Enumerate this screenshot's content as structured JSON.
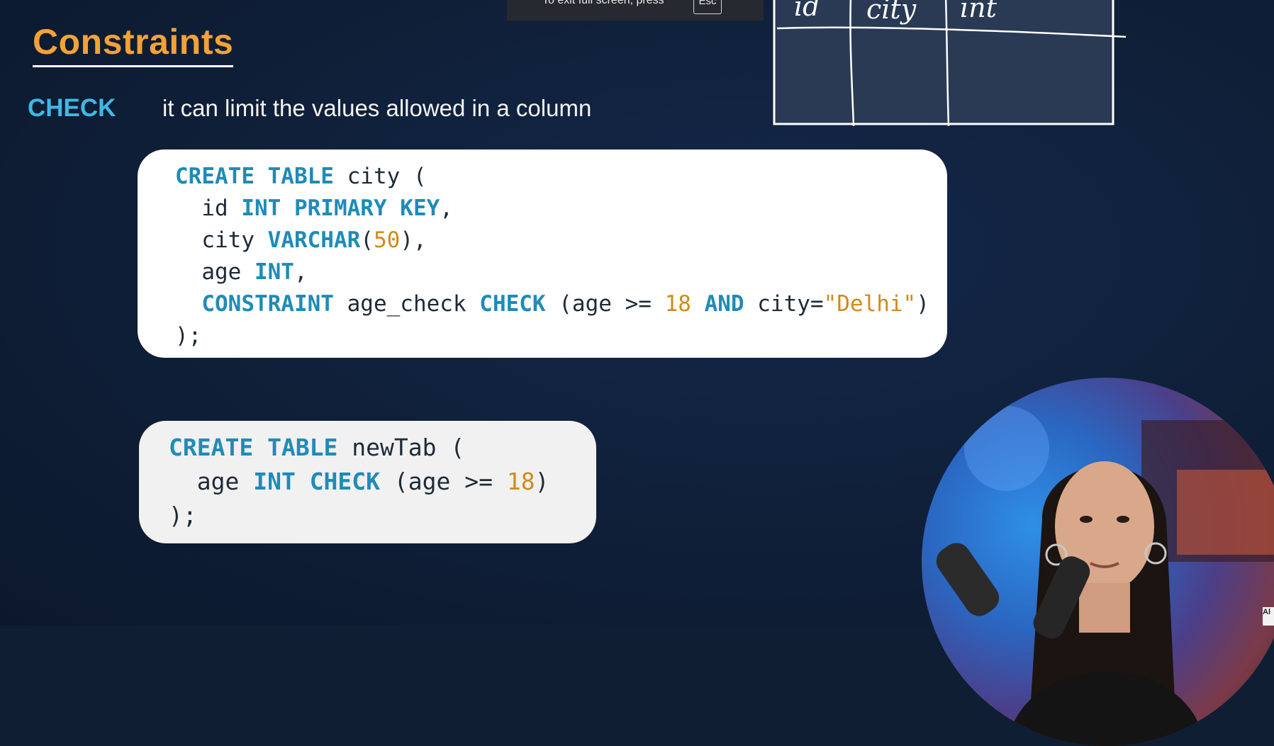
{
  "fullscreen_toast": {
    "message": "To exit full screen, press",
    "key": "Esc"
  },
  "slide": {
    "title": "Constraints",
    "keyword": "CHECK",
    "description": "it can limit the values allowed in a column"
  },
  "sketch_table": {
    "headers": [
      "id",
      "city",
      "int"
    ]
  },
  "code_block_1": {
    "lines": [
      [
        {
          "t": "CREATE TABLE",
          "c": "kw"
        },
        {
          "t": " city ("
        }
      ],
      [
        {
          "t": "  id "
        },
        {
          "t": "INT PRIMARY KEY",
          "c": "kw"
        },
        {
          "t": ","
        }
      ],
      [
        {
          "t": "  city "
        },
        {
          "t": "VARCHAR",
          "c": "kw"
        },
        {
          "t": "("
        },
        {
          "t": "50",
          "c": "num"
        },
        {
          "t": "),"
        }
      ],
      [
        {
          "t": "  age "
        },
        {
          "t": "INT",
          "c": "kw"
        },
        {
          "t": ","
        }
      ],
      [
        {
          "t": "  "
        },
        {
          "t": "CONSTRAINT",
          "c": "kw"
        },
        {
          "t": " age_check "
        },
        {
          "t": "CHECK",
          "c": "kw"
        },
        {
          "t": " (age >= "
        },
        {
          "t": "18",
          "c": "num"
        },
        {
          "t": " "
        },
        {
          "t": "AND",
          "c": "kw"
        },
        {
          "t": " city="
        },
        {
          "t": "\"Delhi\"",
          "c": "str"
        },
        {
          "t": ")"
        }
      ],
      [
        {
          "t": ");"
        }
      ]
    ]
  },
  "code_block_2": {
    "lines": [
      [
        {
          "t": "CREATE TABLE",
          "c": "kw"
        },
        {
          "t": " newTab ("
        }
      ],
      [
        {
          "t": "  age "
        },
        {
          "t": "INT CHECK",
          "c": "kw"
        },
        {
          "t": " (age >= "
        },
        {
          "t": "18",
          "c": "num"
        },
        {
          "t": ")"
        }
      ],
      [
        {
          "t": ");"
        }
      ]
    ]
  },
  "corner_badge": {
    "text": "Al"
  },
  "colors": {
    "background": "#0f1e33",
    "title": "#f2a236",
    "keyword_check": "#3fb8e6",
    "sql_keyword": "#1f8bb8",
    "sql_number": "#d08b1c"
  }
}
